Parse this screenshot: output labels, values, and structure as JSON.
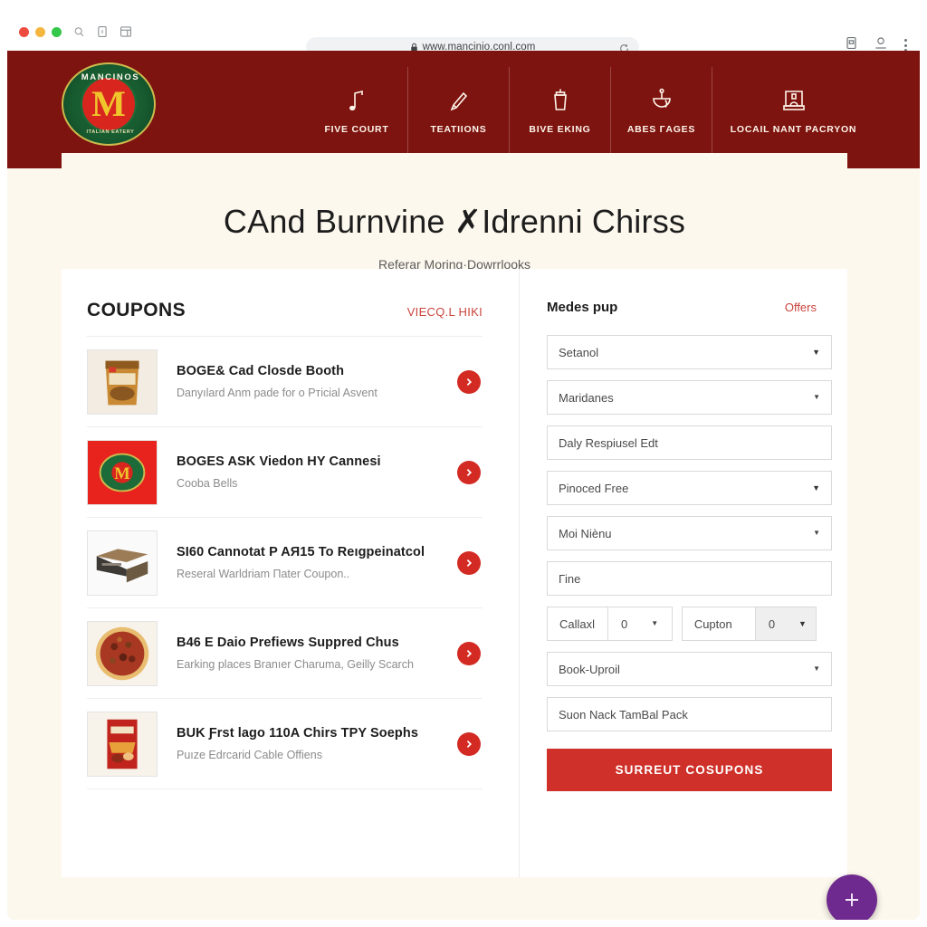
{
  "browser": {
    "url": "www.mancinio.conl.com",
    "icons": {
      "lock": "lock-icon",
      "reload": "reload-icon",
      "search": "search-icon",
      "tab": "tab-icon",
      "panel": "panel-icon",
      "cast": "cast-icon",
      "profile": "profile-icon",
      "menu": "kebab-menu-icon"
    }
  },
  "header": {
    "brand": {
      "name": "MANCINOS",
      "letter": "M",
      "tagline": "ITALIAN EATERY"
    },
    "nav": [
      {
        "label": "FIVE COURT",
        "icon": "music-note-icon"
      },
      {
        "label": "TEATIIONS",
        "icon": "pencil-icon"
      },
      {
        "label": "BIVE EKING",
        "icon": "cup-icon"
      },
      {
        "label": "ABES ГAGES",
        "icon": "bowl-icon"
      },
      {
        "label": "LOCAIL NANT PACRYON",
        "icon": "storefront-icon"
      }
    ]
  },
  "hero": {
    "title": "CAnd Burnvine ✗Idrenni Chirss",
    "subtitle": "Referar Moring·Dowrrlooks"
  },
  "coupons_panel": {
    "title": "COUPONS",
    "link": "VIECQ.L HIKІ",
    "items": [
      {
        "title": "BOGE& Cad Closde Booth",
        "subtitle": "Danyılard Anm pade for o Pтicial Asvent",
        "thumb": "snack-bag-thumb"
      },
      {
        "title": "BOGES ASK Viedon HY Cannesi",
        "subtitle": "Cooba Bells",
        "thumb": "logo-tile-thumb"
      },
      {
        "title": "SI60 Cannotat P AЯ15 To Reıgpeinatcol",
        "subtitle": "Reseral Warldriam Пater Coupon..",
        "thumb": "box-thumb"
      },
      {
        "title": "B46 E Daio Prefiews Suppred Chus",
        "subtitle": "Earking places Branıer Charuma, Geilly Scarch",
        "thumb": "pizza-thumb"
      },
      {
        "title": "BUK Ƒrst lago 110A Chirs TPY Soephs",
        "subtitle": "Puıze Edrcarid Cable Offiens",
        "thumb": "chips-bag-thumb"
      }
    ]
  },
  "form_panel": {
    "title": "Medes pup",
    "link": "Offers",
    "fields": [
      {
        "name": "setanol-select",
        "value": "Setanol",
        "control": "select",
        "caret": "bold"
      },
      {
        "name": "maridanes-select",
        "value": "Maridanes",
        "control": "select",
        "caret": "thin"
      },
      {
        "name": "daly-respiusel-input",
        "value": "Daly Respiusel Edt",
        "control": "text",
        "caret": "none"
      },
      {
        "name": "pinoced-free-select",
        "value": "Pinoced Free",
        "control": "select",
        "caret": "bold"
      },
      {
        "name": "moi-nienu-select",
        "value": "Moi Niènu",
        "control": "select",
        "caret": "thin"
      },
      {
        "name": "fine-input",
        "value": "Гine",
        "control": "text",
        "caret": "none"
      }
    ],
    "stepper_row": [
      {
        "label": "Callaxl",
        "value": "0",
        "shaded": false
      },
      {
        "label": "Cupton",
        "value": "0",
        "shaded": true
      }
    ],
    "fields_bottom": [
      {
        "name": "book-uproil-select",
        "value": "Book-Uproil",
        "control": "select",
        "caret": "thin"
      },
      {
        "name": "suon-nack-input",
        "value": "Suon Nack TamBal Pack",
        "control": "text",
        "caret": "none"
      }
    ],
    "submit_label": "SURREUT COSUPONS"
  },
  "fab": {
    "icon": "plus-icon",
    "color": "#6f2a8f"
  },
  "colors": {
    "header_maroon": "#7e1410",
    "page_cream": "#fdf8ed",
    "accent_red": "#cf3029",
    "link_red": "#c9443c",
    "fab_purple": "#6f2a8f"
  }
}
